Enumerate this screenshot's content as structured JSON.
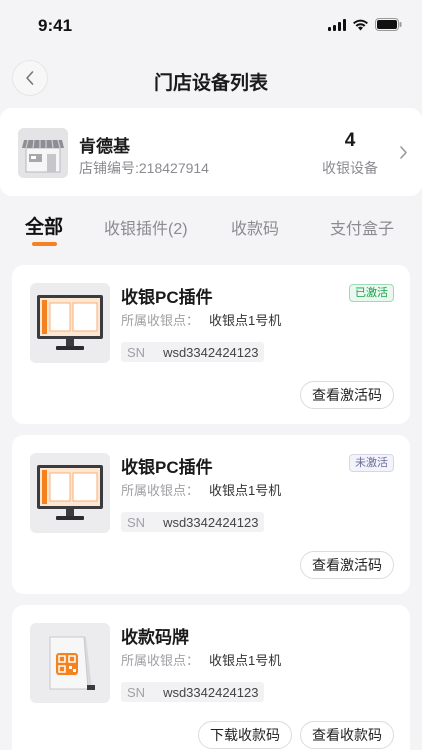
{
  "status_bar": {
    "time": "9:41"
  },
  "nav": {
    "title": "门店设备列表"
  },
  "store": {
    "name": "肯德基",
    "id_text": "店铺编号:218427914",
    "device_count": "4",
    "device_count_label": "收银设备"
  },
  "tabs": [
    {
      "label": "全部",
      "active": true
    },
    {
      "label": "收银插件(2)",
      "active": false
    },
    {
      "label": "收款码",
      "active": false
    },
    {
      "label": "支付盒子",
      "active": false
    }
  ],
  "colors": {
    "accent": "#f58220",
    "active_badge": "#17a34a"
  },
  "devices": [
    {
      "name": "收银PC插件",
      "status": "已激活",
      "point_label": "所属收银点：",
      "point_value": "收银点1号机",
      "sn_label": "SN",
      "sn_value": "wsd3342424123",
      "actions": [
        "查看激活码"
      ],
      "icon": "computer-icon"
    },
    {
      "name": "收银PC插件",
      "status": "未激活",
      "point_label": "所属收银点：",
      "point_value": "收银点1号机",
      "sn_label": "SN",
      "sn_value": "wsd3342424123",
      "actions": [
        "查看激活码"
      ],
      "icon": "computer-icon"
    },
    {
      "name": "收款码牌",
      "point_label": "所属收银点：",
      "point_value": "收银点1号机",
      "sn_label": "SN",
      "sn_value": "wsd3342424123",
      "actions": [
        "下载收款码",
        "查看收款码"
      ],
      "icon": "qr-stand-icon"
    }
  ]
}
